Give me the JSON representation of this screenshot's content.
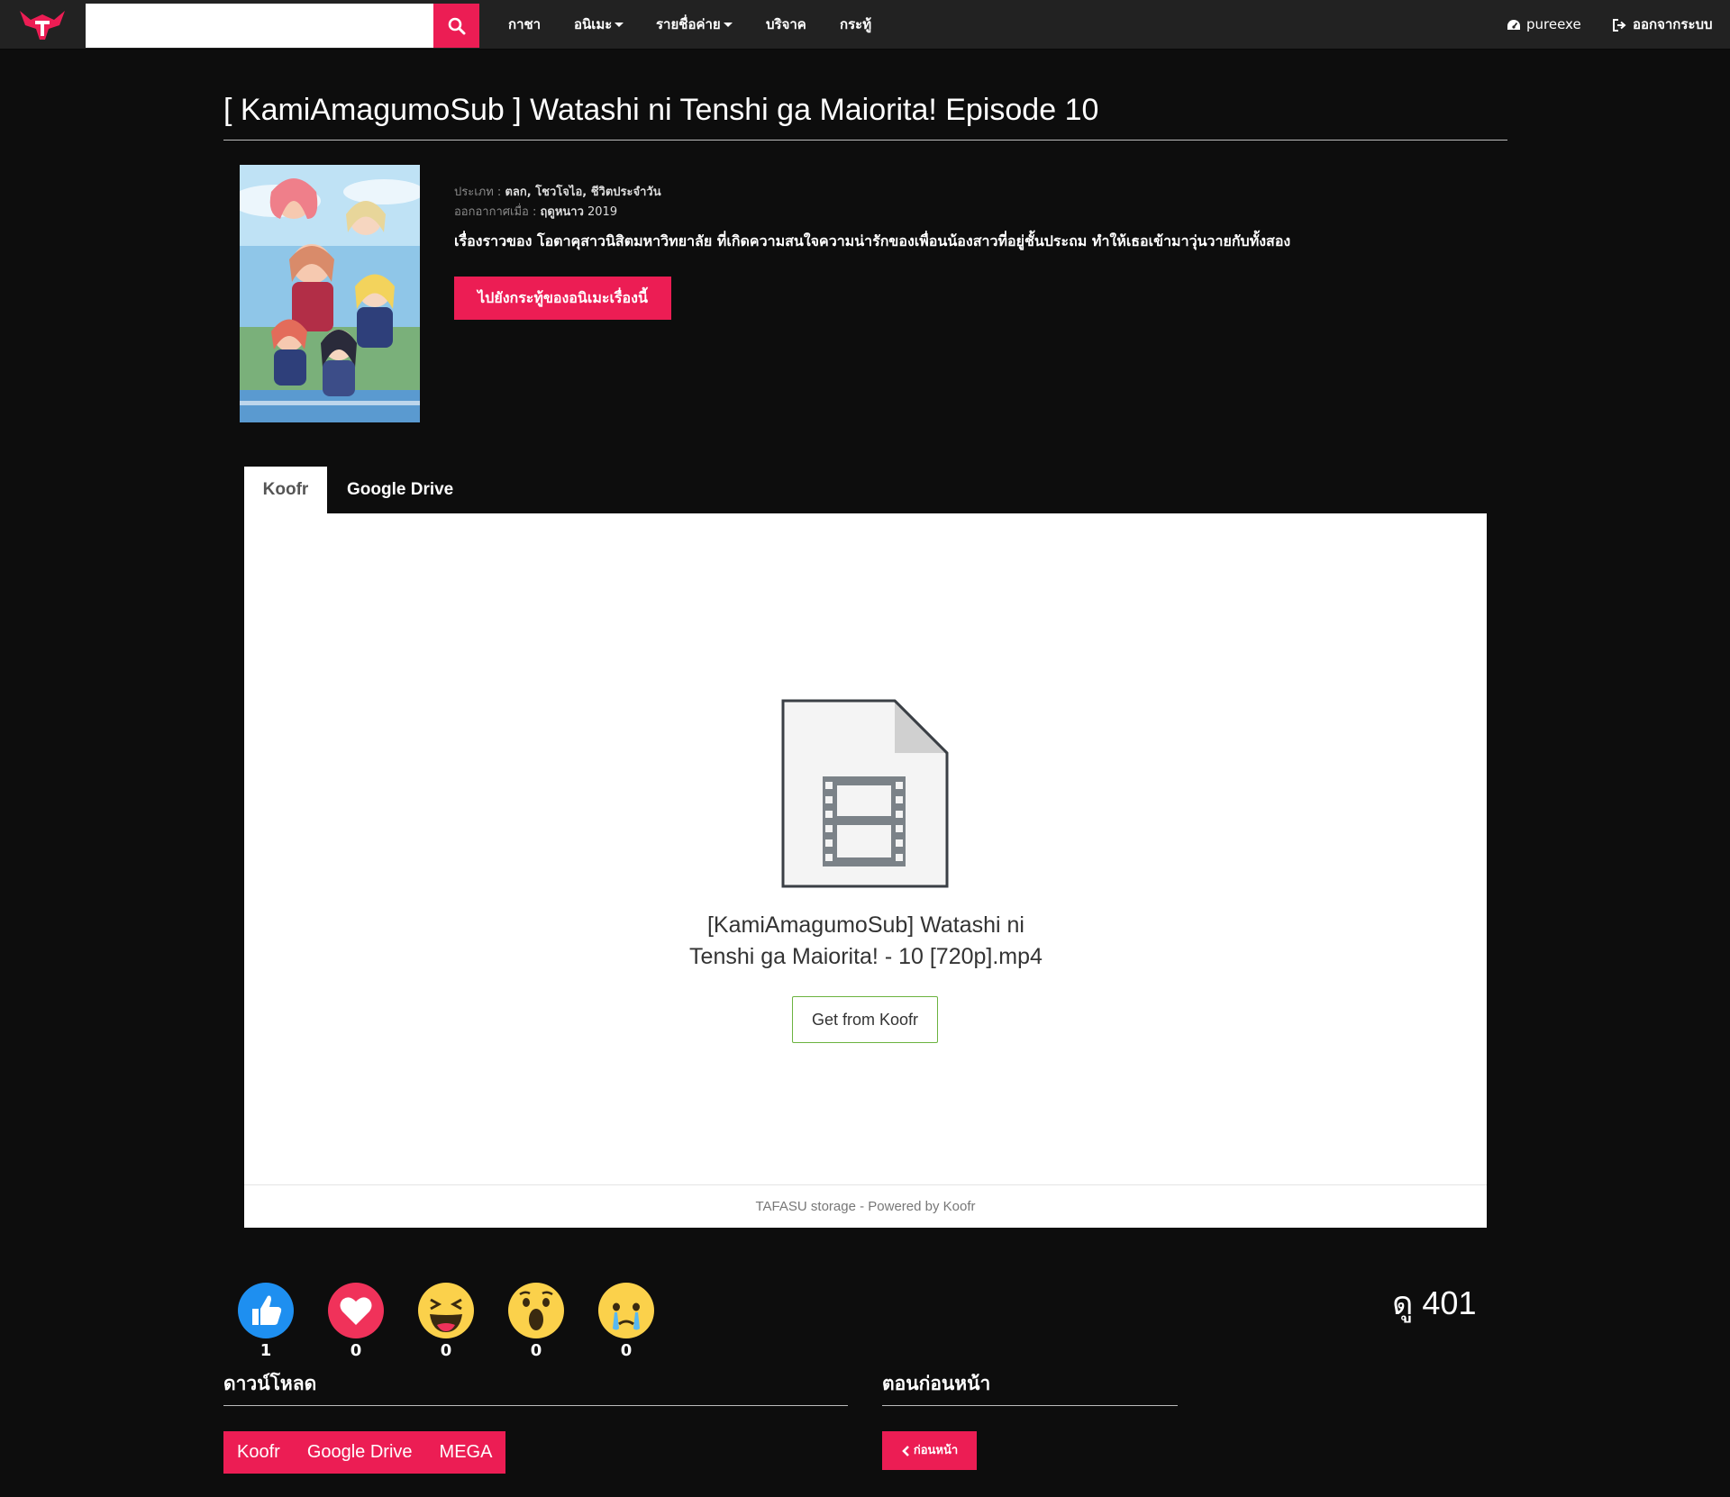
{
  "brand": {
    "logo": "tafasu-logo",
    "accent_color": "#ec1d54"
  },
  "search": {
    "placeholder": "",
    "value": "",
    "icon": "search-icon"
  },
  "nav": {
    "items": [
      {
        "label": "กาชา",
        "has_dropdown": false
      },
      {
        "label": "อนิเมะ",
        "has_dropdown": true
      },
      {
        "label": "รายชื่อค่าย",
        "has_dropdown": true
      },
      {
        "label": "บริจาค",
        "has_dropdown": false
      },
      {
        "label": "กระทู้",
        "has_dropdown": false
      }
    ],
    "user": {
      "icon": "dashboard-icon",
      "label": "pureexe"
    },
    "logout": {
      "icon": "sign-out-icon",
      "label": "ออกจากระบบ"
    }
  },
  "page": {
    "title": "[ KamiAmagumoSub ] Watashi ni Tenshi ga Maiorita! Episode 10"
  },
  "anime": {
    "poster_alt": "Watashi ni Tenshi ga Maiorita! key visual",
    "genre_label": "ประเภท :",
    "genre_value": "ตลก, โชวโจไอ, ชีวิตประจำวัน",
    "aired_label": "ออกอากาศเมื่อ :",
    "aired_month": "ฤดูหนาว",
    "aired_year": "2019",
    "synopsis": "เรื่องราวของ โอตาคุสาวนิสิตมหาวิทยาลัย ที่เกิดความสนใจความน่ารักของเพื่อนน้องสาวที่อยู่ชั้นประถม ทำให้เธอเข้ามาวุ่นวายกับทั้งสอง",
    "goto_button": "ไปยังกระทู้ของอนิเมะเรื่องนี้"
  },
  "player": {
    "tabs": [
      {
        "label": "Koofr",
        "active": true
      },
      {
        "label": "Google Drive",
        "active": false
      }
    ],
    "file_icon": "video-file-icon",
    "file_name_line1": "[KamiAmagumoSub] Watashi ni",
    "file_name_line2": "Tenshi ga Maiorita! - 10 [720p].mp4",
    "get_button": "Get from Koofr",
    "footer": "TAFASU storage - Powered by Koofr"
  },
  "reactions": [
    {
      "name": "like",
      "icon": "thumbs-up-icon",
      "count": "1",
      "color": "#1e8ff0"
    },
    {
      "name": "love",
      "icon": "heart-icon",
      "count": "0",
      "color": "#f0325a"
    },
    {
      "name": "haha",
      "icon": "laugh-icon",
      "count": "0",
      "color": "#fbd14b"
    },
    {
      "name": "wow",
      "icon": "wow-icon",
      "count": "0",
      "color": "#fbd14b"
    },
    {
      "name": "sad",
      "icon": "cry-icon",
      "count": "0",
      "color": "#fbd14b"
    }
  ],
  "views": {
    "label": "ดู",
    "count": "401"
  },
  "download": {
    "heading": "ดาวน์โหลด",
    "links": [
      "Koofr",
      "Google Drive",
      "MEGA"
    ]
  },
  "previous": {
    "heading": "ตอนก่อนหน้า",
    "button": "ก่อนหน้า",
    "icon": "chevron-left-icon"
  }
}
